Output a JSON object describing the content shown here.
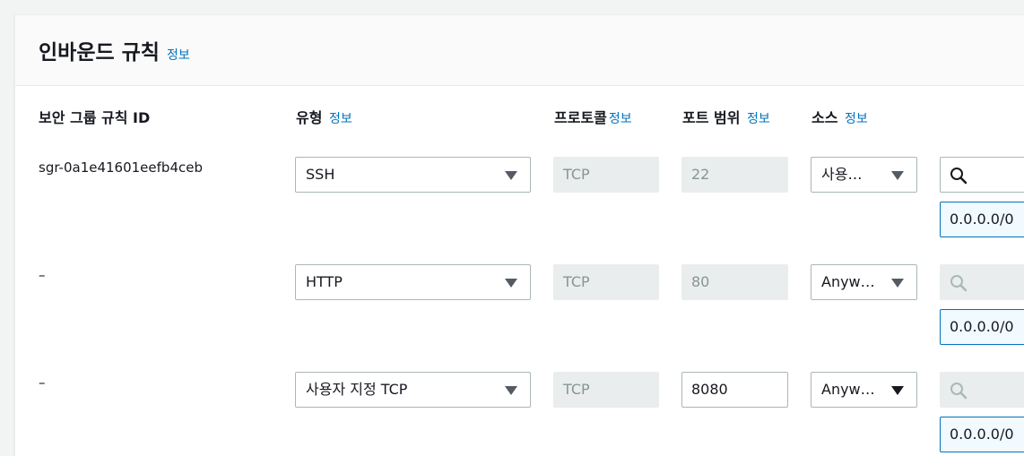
{
  "panel": {
    "title": "인바운드 규칙",
    "title_info": "정보"
  },
  "columns": {
    "rule_id": "보안 그룹 규칙 ID",
    "type": "유형",
    "type_info": "정보",
    "protocol": "프로토콜",
    "protocol_info": "정보",
    "port_range": "포트 범위",
    "port_range_info": "정보",
    "source": "소스",
    "source_info": "정보"
  },
  "rows": [
    {
      "rule_id": "sgr-0a1e41601eefb4ceb",
      "type": "SSH",
      "protocol": "TCP",
      "port_range": "22",
      "source": "사용…",
      "cidr": "0.0.0.0/0"
    },
    {
      "rule_id": "–",
      "type": "HTTP",
      "protocol": "TCP",
      "port_range": "80",
      "source": "Anyw…",
      "cidr": "0.0.0.0/0"
    },
    {
      "rule_id": "–",
      "type": "사용자 지정 TCP",
      "protocol": "TCP",
      "port_range": "8080",
      "source": "Anyw…",
      "cidr": "0.0.0.0/0"
    }
  ],
  "icons": {
    "dropdown": "caret-down-icon",
    "search": "search-icon"
  }
}
